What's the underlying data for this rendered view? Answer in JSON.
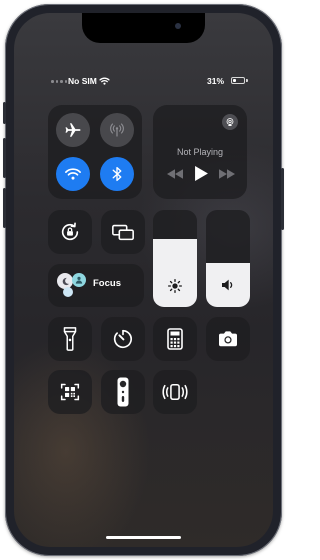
{
  "status_bar": {
    "carrier": "No SIM",
    "battery_text": "31%",
    "battery_level": 0.31
  },
  "connectivity": {
    "airplane": {
      "icon": "airplane-icon",
      "enabled": false,
      "color": "#555559"
    },
    "cellular": {
      "icon": "cellular-antenna-icon",
      "enabled": false
    },
    "wifi": {
      "icon": "wifi-icon",
      "enabled": true,
      "color": "#1e7cf2"
    },
    "bluetooth": {
      "icon": "bluetooth-icon",
      "enabled": true,
      "color": "#1e7cf2"
    }
  },
  "now_playing": {
    "title": "Not Playing",
    "airplay_icon": "airplay-icon",
    "controls": [
      "backward-icon",
      "play-icon",
      "forward-icon"
    ]
  },
  "toggles": {
    "orientation_lock": {
      "icon": "orientation-lock-icon",
      "enabled": false
    },
    "screen_mirroring": {
      "icon": "screen-mirroring-icon",
      "enabled": false
    }
  },
  "focus": {
    "label": "Focus",
    "icon": "focus-moon-icon"
  },
  "sliders": {
    "brightness": {
      "icon": "sun-icon",
      "level": 0.7
    },
    "volume": {
      "icon": "speaker-icon",
      "level": 0.45
    }
  },
  "shortcuts": [
    {
      "name": "flashlight",
      "icon": "flashlight-icon"
    },
    {
      "name": "timer",
      "icon": "timer-icon"
    },
    {
      "name": "calculator",
      "icon": "calculator-icon"
    },
    {
      "name": "camera",
      "icon": "camera-icon"
    },
    {
      "name": "code-scanner",
      "icon": "qr-code-scanner-icon"
    },
    {
      "name": "apple-tv-remote",
      "icon": "tv-remote-icon"
    },
    {
      "name": "sound-recognition",
      "icon": "sound-recognition-icon"
    }
  ],
  "colors": {
    "accent": "#1e7cf2",
    "focus_accent": "#f39a20"
  }
}
